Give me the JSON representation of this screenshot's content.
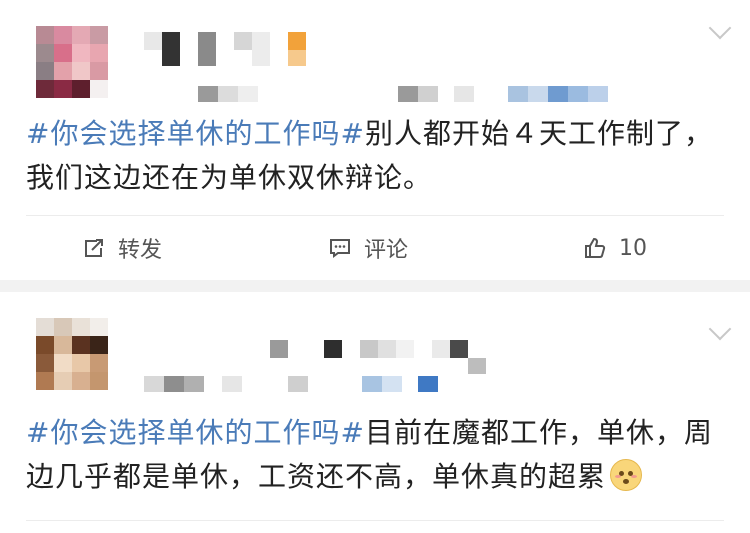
{
  "posts": [
    {
      "hashtag": "#你会选择单休的工作吗#",
      "body": "别人都开始４天工作制了，我们这边还在为单休双休辩论。",
      "actions": {
        "repost_label": "转发",
        "comment_label": "评论",
        "like_count": "10"
      }
    },
    {
      "hashtag": "#你会选择单休的工作吗#",
      "body": "目前在魔都工作，单休，周边几乎都是单休，工资还不高，单休真的超累",
      "emoji": "flushed-face-icon"
    }
  ],
  "colors": {
    "hashtag": "#4a7bb8",
    "text": "#222222",
    "action_text": "#555555",
    "background": "#f2f2f2"
  }
}
